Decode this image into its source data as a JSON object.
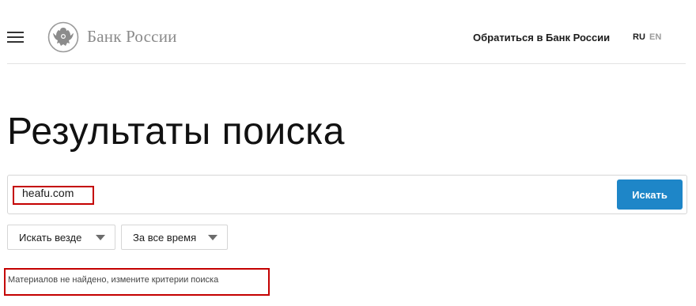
{
  "header": {
    "bank_name": "Банк России",
    "contact_link": "Обратиться в Банк России",
    "languages": {
      "ru": "RU",
      "en": "EN"
    }
  },
  "page": {
    "title": "Результаты поиска"
  },
  "search": {
    "query_value": "heafu.com",
    "button_label": "Искать"
  },
  "filters": {
    "scope": {
      "selected": "Искать везде"
    },
    "period": {
      "selected": "За все время"
    }
  },
  "results": {
    "message": "Материалов не найдено, измените критерии поиска"
  },
  "colors": {
    "accent": "#1e86c8",
    "highlight": "#c40000"
  },
  "icons": [
    "hamburger-menu-icon",
    "bank-emblem-icon",
    "dropdown-arrow-icon"
  ]
}
